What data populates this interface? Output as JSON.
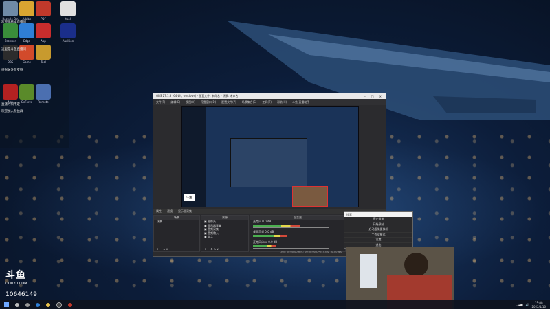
{
  "desktop": {
    "icons": [
      {
        "label": "Recycle Bin",
        "color": "#6f8aa6"
      },
      {
        "label": "Adobe",
        "color": "#d9a531"
      },
      {
        "label": "PDF",
        "color": "#c0392b"
      },
      {
        "label": "tool",
        "color": "#e0e0e0"
      },
      {
        "label": "Browser",
        "color": "#3a8d3a"
      },
      {
        "label": "Edge",
        "color": "#2f7fd6"
      },
      {
        "label": "App",
        "color": "#c92d2d"
      },
      {
        "label": "Audition",
        "color": "#1a2e8a"
      },
      {
        "label": "OBS",
        "color": "#2c2c2c"
      },
      {
        "label": "Game",
        "color": "#d24a2b"
      },
      {
        "label": "Tool",
        "color": "#c89a2e"
      },
      {
        "label": "App",
        "color": "#b32121"
      },
      {
        "label": "GeForce",
        "color": "#5a8a2a"
      },
      {
        "label": "Remote",
        "color": "#4b6fb0"
      }
    ],
    "notes": [
      "欢迎观看本直播间",
      "这里是斗鱼直播间",
      "感谢关注与支持",
      "直播时间不定",
      "欢迎加入粉丝群"
    ]
  },
  "obs": {
    "title": "OBS 27.1.3 (64-bit, windows) - 配置文件: 未命名 - 场景: 未命名",
    "menu": [
      "文件(F)",
      "编辑(E)",
      "视图(V)",
      "停靠窗口(D)",
      "配置文件(P)",
      "场景集合(S)",
      "工具(T)",
      "帮助(H)",
      "斗鱼·直播助手"
    ],
    "scene_bar": [
      "属性",
      "滤镜",
      "显示器采集"
    ],
    "docks": {
      "scenes": {
        "title": "场景",
        "items": [
          "场景"
        ]
      },
      "sources": {
        "title": "来源",
        "items": [
          "摄像头",
          "显示器采集",
          "音频采集",
          "音频输入",
          "文字"
        ]
      },
      "mixer": {
        "title": "混音器",
        "channels": [
          {
            "name": "麦克风",
            "db": "0.0 dB",
            "level": 0.62
          },
          {
            "name": "桌面音频",
            "db": "0.0 dB",
            "level": 0.45
          },
          {
            "name": "麦克风/Aux",
            "db": "0.0 dB",
            "level": 0.3
          }
        ]
      }
    },
    "status": "LIVE: 00:00:00  REC: 00:00:00  CPU: 3.5%, 30.00 fps"
  },
  "context_menu": {
    "search_placeholder": "搜索",
    "items": [
      "停止推流",
      "开始录制",
      "启动虚拟摄像机",
      "工作室模式",
      "设置",
      "退出"
    ]
  },
  "overlay": {
    "logo_text": "斗鱼",
    "logo_sub": "DOUYU.COM",
    "room_id": "10646149"
  },
  "taskbar": {
    "time": "15:00",
    "date": "2022/1/10",
    "tray_icons": [
      "network",
      "volume",
      "lang"
    ]
  }
}
